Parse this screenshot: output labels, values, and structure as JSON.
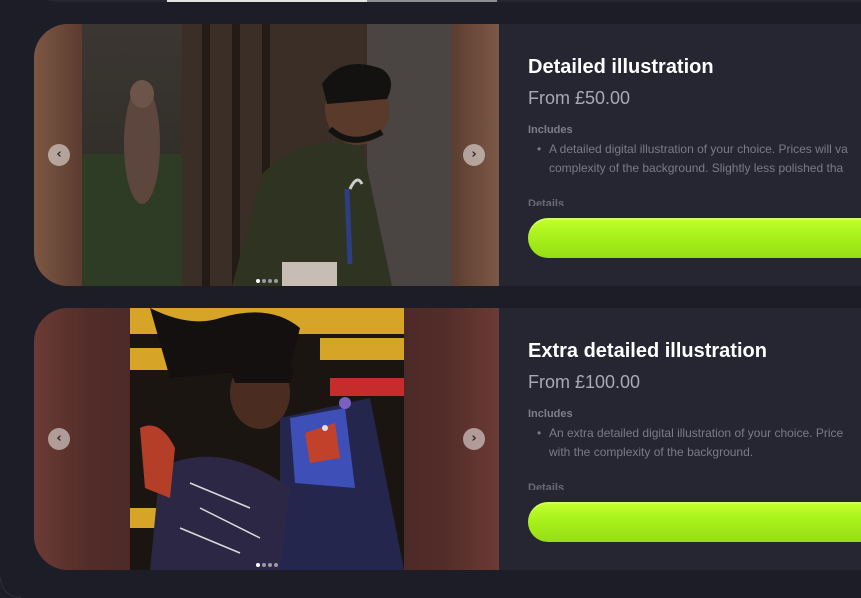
{
  "carousel_nav": {
    "prev_symbol": "‹",
    "next_symbol": "›"
  },
  "products": [
    {
      "title": "Detailed illustration",
      "price": "From £50.00",
      "includes_label": "Includes",
      "description_lines": [
        "A detailed digital illustration of your choice. Prices will va",
        "complexity of the background. Slightly less polished tha"
      ],
      "details_label": "Details",
      "slide_count": 4,
      "active_slide": 1
    },
    {
      "title": "Extra detailed illustration",
      "price": "From £100.00",
      "includes_label": "Includes",
      "description_lines": [
        "An extra detailed digital illustration of your choice. Price",
        "with the complexity of the background."
      ],
      "details_label": "Details",
      "slide_count": 4,
      "active_slide": 1
    }
  ],
  "colors": {
    "background": "#1d1d27",
    "card": "#262633",
    "accent_button": "#b6f722",
    "title": "#ffffff",
    "price": "#a9a9b4"
  }
}
